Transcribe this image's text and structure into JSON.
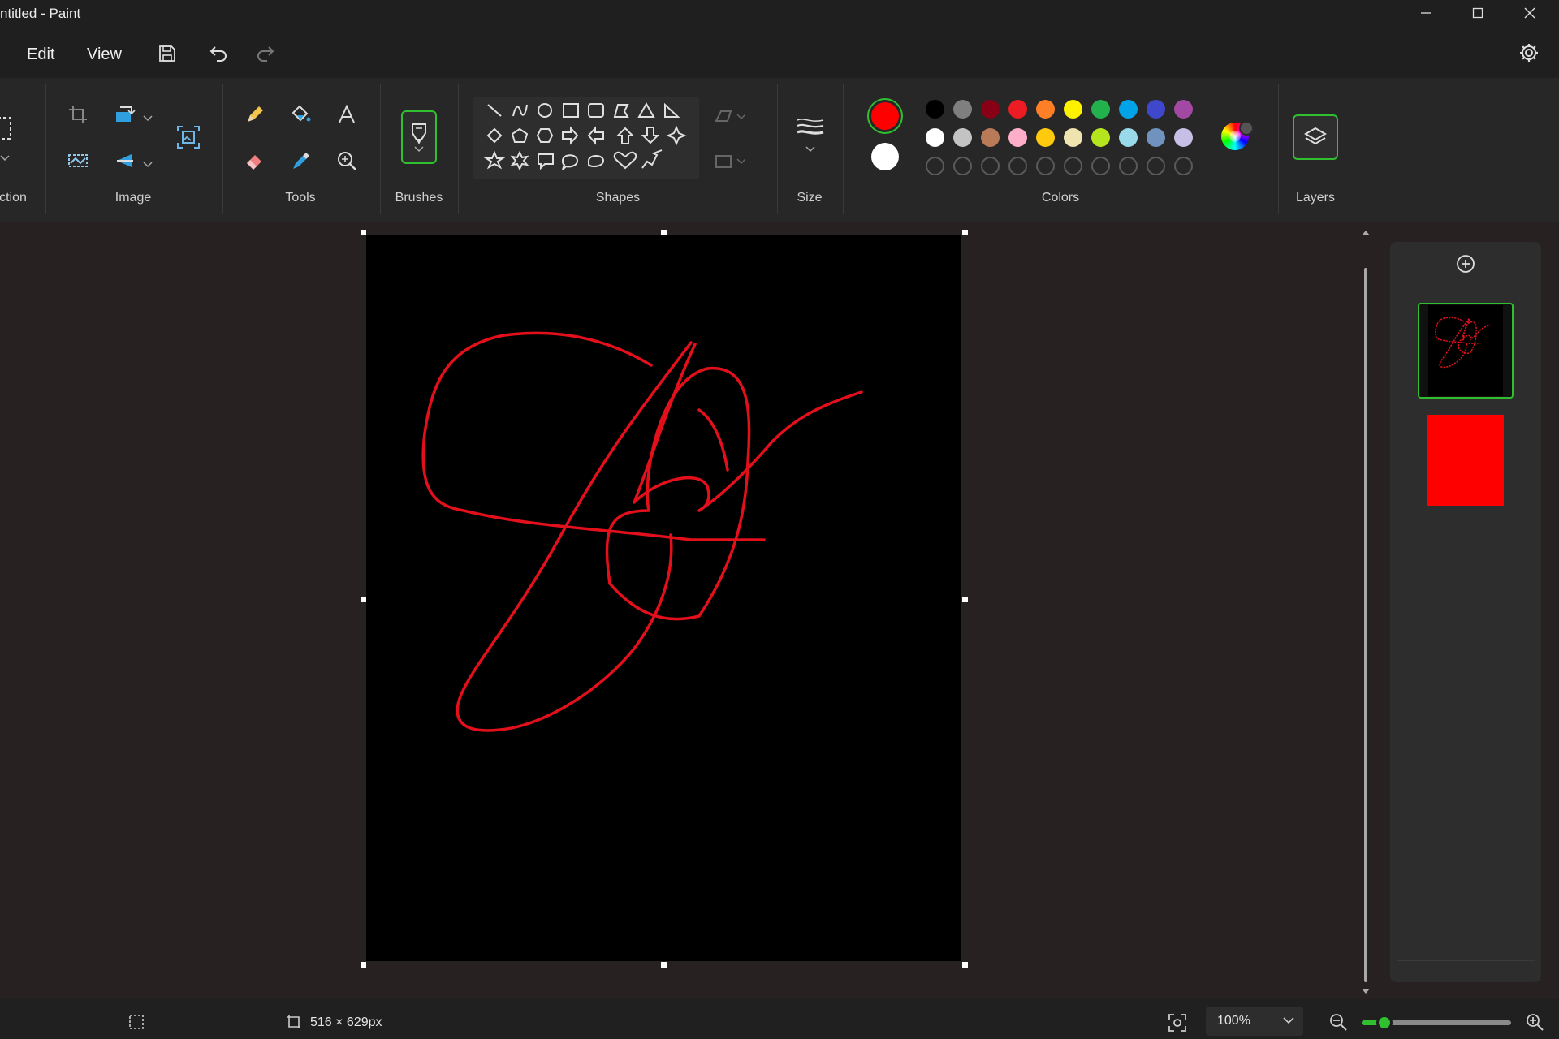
{
  "window": {
    "title": "ntitled - Paint"
  },
  "menu": {
    "edit_label": "Edit",
    "view_label": "View"
  },
  "ribbon": {
    "groups": {
      "selection": "ction",
      "image": "Image",
      "tools": "Tools",
      "brushes": "Brushes",
      "shapes": "Shapes",
      "size": "Size",
      "colors": "Colors",
      "layers": "Layers"
    },
    "selected_primary_color": "#ff0000",
    "selected_secondary_color": "#ffffff",
    "palette_row1": [
      "#000000",
      "#7f7f7f",
      "#880015",
      "#ed1c24",
      "#ff7f27",
      "#fff200",
      "#22b14c",
      "#00a2e8",
      "#3f48cc",
      "#a349a4"
    ],
    "palette_row2": [
      "#ffffff",
      "#c3c3c3",
      "#b97a57",
      "#ffaec9",
      "#ffc90e",
      "#efe4b0",
      "#b5e61d",
      "#99d9ea",
      "#7092be",
      "#c8bfe7"
    ],
    "custom_color_slots": 10
  },
  "canvas": {
    "stroke_color": "#e3101c",
    "background": "#000000"
  },
  "layers": {
    "active_layer_border": "#2fbf2f",
    "background_layer_color": "#ff0000"
  },
  "status": {
    "canvas_size": "516 × 629px",
    "zoom": "100%",
    "zoom_level_fraction": 0.15
  }
}
